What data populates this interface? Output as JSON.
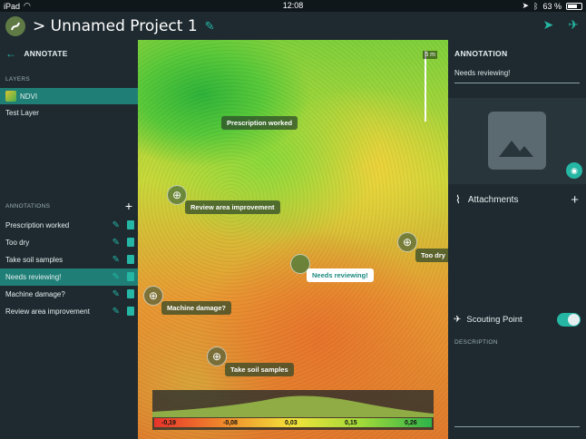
{
  "status": {
    "device": "iPad",
    "time": "12:08",
    "battery": "63 %"
  },
  "header": {
    "title": "> Unnamed Project 1"
  },
  "left": {
    "title": "ANNOTATE",
    "layers_label": "LAYERS",
    "layers": [
      {
        "label": "NDVI",
        "active": true
      },
      {
        "label": "Test Layer",
        "active": false
      }
    ],
    "annotations_label": "ANNOTATIONS",
    "annotations": [
      {
        "label": "Prescription worked",
        "active": false
      },
      {
        "label": "Too dry",
        "active": false
      },
      {
        "label": "Take soil samples",
        "active": false
      },
      {
        "label": "Needs reviewing!",
        "active": true
      },
      {
        "label": "Machine damage?",
        "active": false
      },
      {
        "label": "Review area improvement",
        "active": false
      }
    ]
  },
  "map": {
    "scale_label": "5 m",
    "callouts": {
      "prescription": "Prescription worked",
      "review": "Review area improvement",
      "toodry": "Too dry",
      "needs": "Needs reviewing!",
      "machine": "Machine damage?",
      "soil": "Take soil samples"
    },
    "legend_ticks": [
      "-0,19",
      "-0,08",
      "0,03",
      "0,15",
      "0,26"
    ]
  },
  "right": {
    "title": "ANNOTATION",
    "name_value": "Needs reviewing!",
    "attachments_label": "Attachments",
    "scouting_label": "Scouting Point",
    "scouting_on": true,
    "description_label": "DESCRIPTION"
  },
  "colors": {
    "accent": "#25b6a4",
    "active_row": "#1f7f76",
    "panel": "#1e2a30"
  }
}
